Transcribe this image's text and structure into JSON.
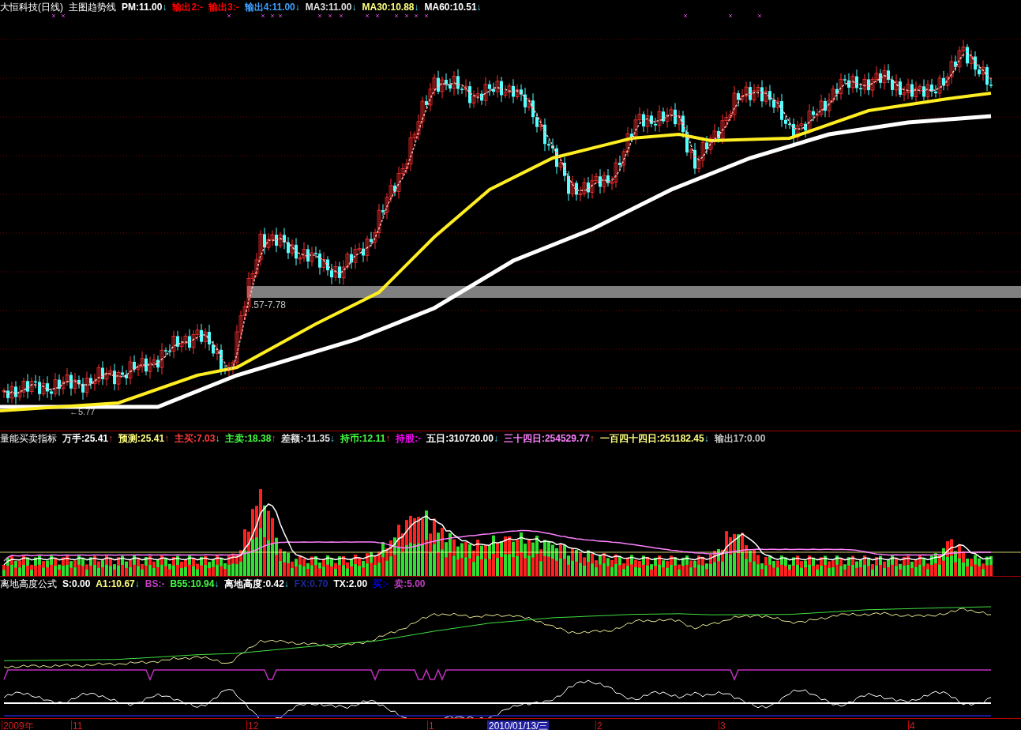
{
  "main_panel": {
    "title": "大恒科技(日线)",
    "indicator": "主图趋势线",
    "readings": [
      {
        "text": "PM:11.00",
        "color": "#ffffff",
        "kind": "falling",
        "arrow": "↓"
      },
      {
        "text": "输出2:-",
        "color": "#ff0000",
        "kind": "plain"
      },
      {
        "text": "输出3:-",
        "color": "#ff0000",
        "kind": "plain"
      },
      {
        "text": "输出4:11.00",
        "color": "#3fa0ff",
        "kind": "falling",
        "arrow": "↓"
      },
      {
        "text": "MA3:11.00",
        "color": "#e0e0e0",
        "kind": "falling",
        "arrow": "↓"
      },
      {
        "text": "MA30:10.88",
        "color": "#ffff80",
        "kind": "falling",
        "arrow": "↓"
      },
      {
        "text": "MA60:10.51",
        "color": "#ffffff",
        "kind": "falling",
        "arrow": "↓"
      }
    ],
    "range_label": ".57-7.78",
    "low_label": "←5.77"
  },
  "volume_panel": {
    "title": "量能买卖指标",
    "readings": [
      {
        "text": "万手:25.41",
        "color": "#ffffff",
        "kind": "rising",
        "arrow": "↑"
      },
      {
        "text": "预测:25.41",
        "color": "#ffff80",
        "kind": "rising",
        "arrow": "↑"
      },
      {
        "text": "主买:7.03",
        "color": "#ff3b3b",
        "kind": "falling",
        "arrow": "↓"
      },
      {
        "text": "主卖:18.38",
        "color": "#40ff40",
        "kind": "rising",
        "arrow": "↑"
      },
      {
        "text": "差额:-11.35",
        "color": "#e0e0e0",
        "kind": "falling",
        "arrow": "↓"
      },
      {
        "text": "持币:12.11",
        "color": "#40ff40",
        "kind": "rising",
        "arrow": "↑"
      },
      {
        "text": "持股:-",
        "color": "#ff00ff",
        "kind": "plain"
      },
      {
        "text": "五日:310720.00",
        "color": "#ffffff",
        "kind": "falling",
        "arrow": "↓"
      },
      {
        "text": "三十四日:254529.77",
        "color": "#ff80ff",
        "kind": "rising",
        "arrow": "↑"
      },
      {
        "text": "一百四十四日:251182.45",
        "color": "#ffff80",
        "kind": "falling",
        "arrow": "↓"
      },
      {
        "text": "输出17:0.00",
        "color": "#c0c0c0",
        "kind": "plain"
      }
    ]
  },
  "height_panel": {
    "title": "离地高度公式",
    "readings": [
      {
        "text": "S:0.00",
        "color": "#ffffff",
        "kind": "plain"
      },
      {
        "text": "A1:10.67",
        "color": "#ffff80",
        "kind": "falling",
        "arrow": "↓"
      },
      {
        "text": "BS:-",
        "color": "#c040c0",
        "kind": "plain"
      },
      {
        "text": "B55:10.94",
        "color": "#40ff40",
        "kind": "falling",
        "arrow": "↓"
      },
      {
        "text": "离地高度:0.42",
        "color": "#ffffff",
        "kind": "falling",
        "arrow": "↓"
      },
      {
        "text": "FX:0.70",
        "color": "#1a2a9a",
        "kind": "plain"
      },
      {
        "text": "TX:2.00",
        "color": "#ffffff",
        "kind": "plain"
      },
      {
        "text": "买:-",
        "color": "#0000ff",
        "kind": "plain"
      },
      {
        "text": "卖:5.00",
        "color": "#c040c0",
        "kind": "plain"
      }
    ]
  },
  "time_axis": [
    {
      "label": "2009年",
      "selected": false
    },
    {
      "label": "11",
      "selected": false
    },
    {
      "label": "12",
      "selected": false
    },
    {
      "label": "1",
      "selected": false
    },
    {
      "label": "2010/01/13/三",
      "selected": true
    },
    {
      "label": "2",
      "selected": false
    },
    {
      "label": "3",
      "selected": false
    },
    {
      "label": "4",
      "selected": false
    }
  ]
}
